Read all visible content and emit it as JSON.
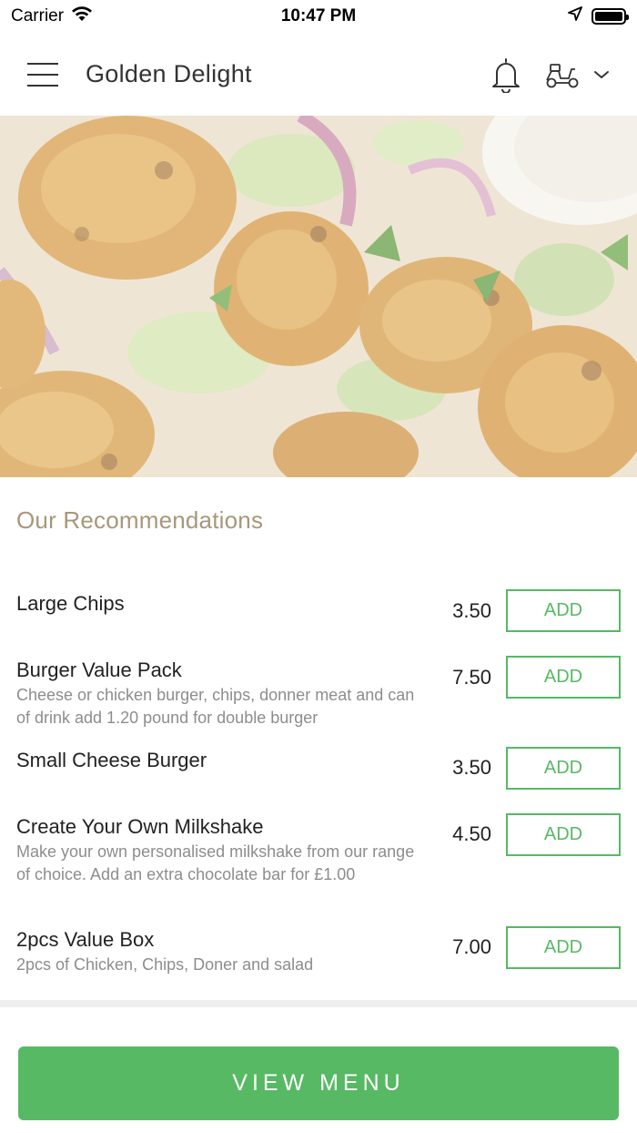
{
  "status_bar": {
    "carrier": "Carrier",
    "time": "10:47 PM"
  },
  "header": {
    "title": "Golden Delight",
    "icons": [
      "menu-icon",
      "bell-icon",
      "scooter-icon",
      "chevron-down-icon"
    ]
  },
  "hero": {
    "image": "chicken-tikka-photo"
  },
  "recommendations": {
    "title": "Our Recommendations",
    "items": [
      {
        "name": "Large Chips",
        "description": "",
        "price": "3.50",
        "button": "ADD"
      },
      {
        "name": "Burger Value Pack",
        "description": "Cheese or chicken burger, chips, donner meat and can of drink add 1.20 pound for double burger",
        "price": "7.50",
        "button": "ADD"
      },
      {
        "name": "Small Cheese Burger",
        "description": "",
        "price": "3.50",
        "button": "ADD"
      },
      {
        "name": "Create Your Own Milkshake",
        "description": "Make your own personalised milkshake from our range of choice. Add an extra chocolate bar for £1.00",
        "price": "4.50",
        "button": "ADD"
      },
      {
        "name": "2pcs Value Box",
        "description": "2pcs of Chicken, Chips, Doner and salad",
        "price": "7.00",
        "button": "ADD"
      }
    ]
  },
  "footer": {
    "view_menu_label": "VIEW MENU"
  },
  "colors": {
    "accent_green": "#57b963",
    "section_title": "#a8977a",
    "description_grey": "#8d8d8d"
  }
}
